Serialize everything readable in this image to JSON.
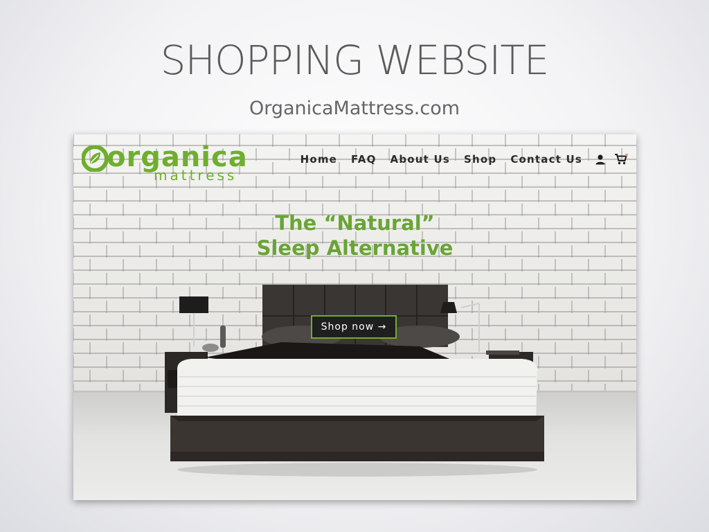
{
  "slide": {
    "title": "SHOPPING WEBSITE",
    "subtitle": "OrganicaMattress.com"
  },
  "site": {
    "logo": {
      "word": "organica",
      "sub": "mattress"
    },
    "nav": {
      "items": [
        "Home",
        "FAQ",
        "About Us",
        "Shop",
        "Contact Us"
      ],
      "icons": [
        "user-icon",
        "cart-icon"
      ]
    },
    "hero": {
      "title_line1": "The “Natural”",
      "title_line2": "Sleep Alternative",
      "cta_label": "Shop now →"
    },
    "colors": {
      "brand_green": "#6fae2e",
      "headline_green": "#6aa436",
      "cta_background": "#1f1f1f"
    }
  }
}
